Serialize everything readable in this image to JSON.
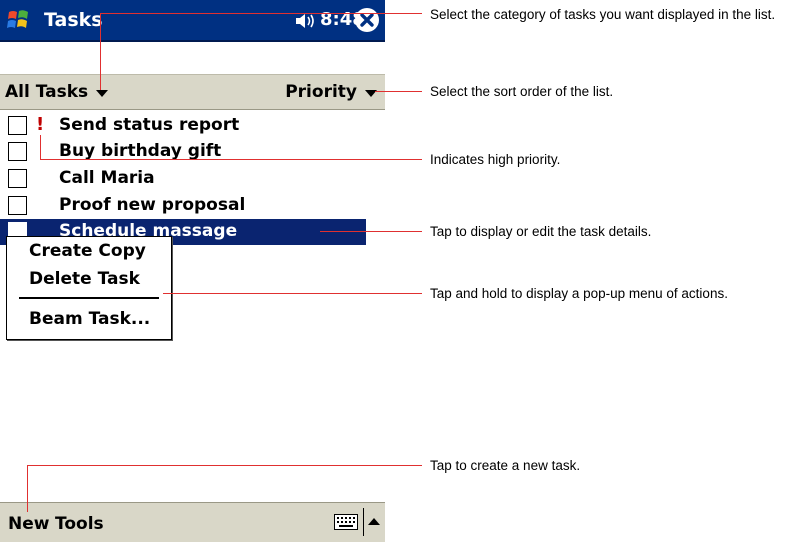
{
  "titlebar": {
    "app_title": "Tasks",
    "time": "8:48"
  },
  "filterbar": {
    "category": "All Tasks",
    "sort": "Priority"
  },
  "tasks": [
    {
      "label": "Send status report",
      "priority": "!",
      "selected": false
    },
    {
      "label": "Buy birthday gift",
      "priority": "",
      "selected": false
    },
    {
      "label": "Call Maria",
      "priority": "",
      "selected": false
    },
    {
      "label": "Proof new proposal",
      "priority": "",
      "selected": false
    },
    {
      "label": "Schedule massage",
      "priority": "",
      "selected": true
    }
  ],
  "popup_menu": {
    "items": [
      "Create Copy",
      "Delete Task",
      "Beam Task..."
    ]
  },
  "cmdbar": {
    "new_label": "New",
    "tools_label": "Tools"
  },
  "callouts": [
    "Select the category of tasks you want displayed in the list.",
    "Select the sort order of the list.",
    "Indicates high priority.",
    "Tap to display or edit the task details.",
    "Tap and hold to display a pop-up menu of actions.",
    "Tap to create a new task."
  ],
  "colors": {
    "titlebar": "#003082",
    "selection": "#0a2470",
    "bar": "#d9d7c8",
    "leader": "#e03030",
    "priority": "#c00000"
  },
  "icons": [
    "windows-start-icon",
    "speaker-icon",
    "close-icon",
    "keyboard-icon",
    "sip-arrow-up-icon"
  ]
}
